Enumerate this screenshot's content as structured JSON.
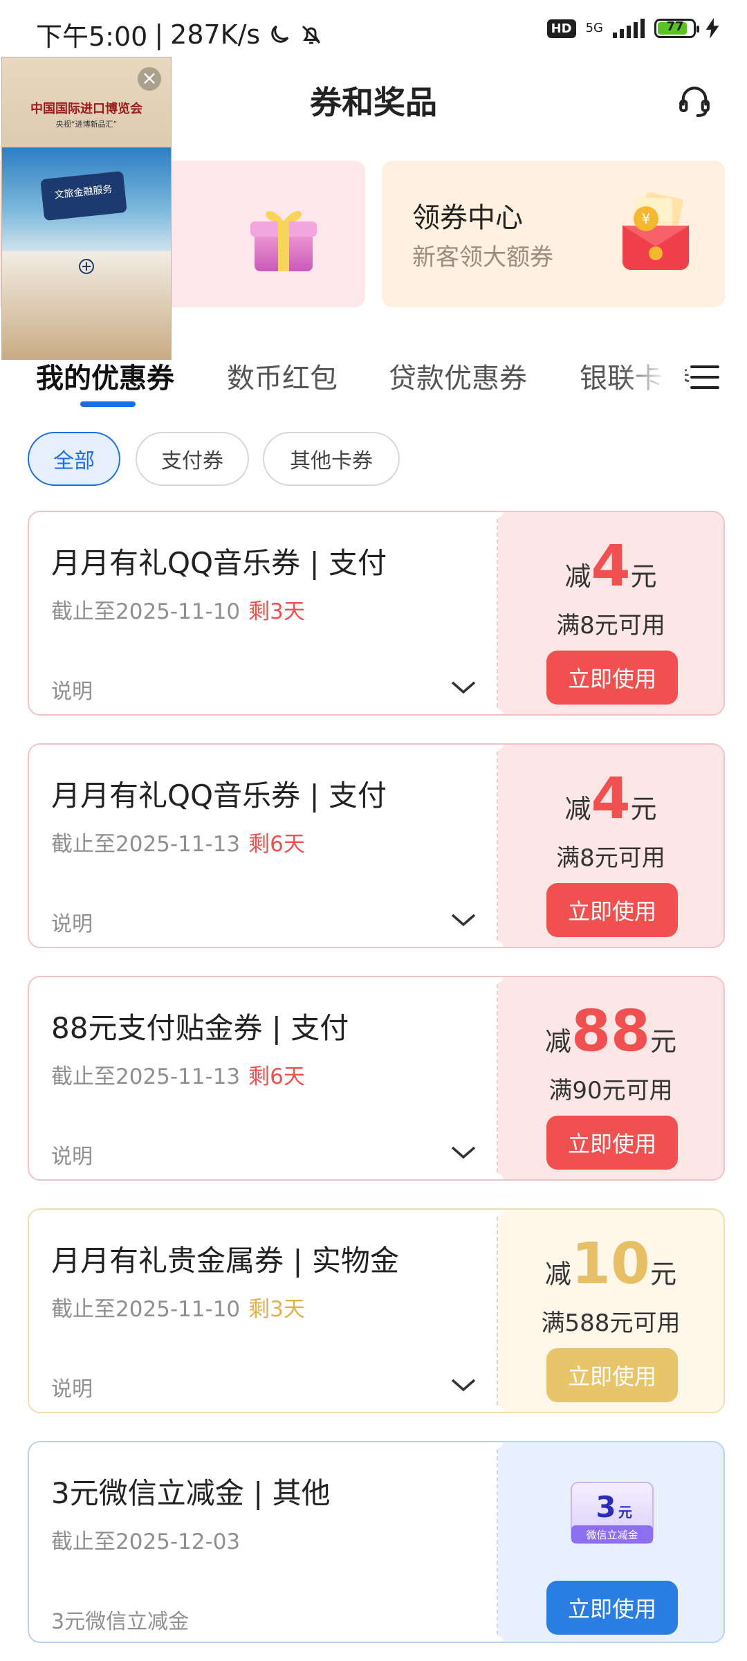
{
  "status_bar": {
    "time": "下午5:00",
    "speed": "287K/s",
    "hd": "HD",
    "network": "5G",
    "battery": "77"
  },
  "header": {
    "title": "券和奖品"
  },
  "promo": {
    "right_title": "领券中心",
    "right_subtitle": "新客领大额券"
  },
  "ad": {
    "headline": "中国国际进口博览会",
    "subline": "央视“进博新品汇”",
    "badge": "文旅金融服务"
  },
  "tabs": [
    {
      "label": "我的优惠券",
      "active": true
    },
    {
      "label": "数币红包",
      "active": false
    },
    {
      "label": "贷款优惠券",
      "active": false
    },
    {
      "label": "银联卡券",
      "active": false
    }
  ],
  "filters": [
    {
      "label": "全部",
      "active": true
    },
    {
      "label": "支付券",
      "active": false
    },
    {
      "label": "其他卡券",
      "active": false
    }
  ],
  "coupons": [
    {
      "title": "月月有礼QQ音乐券 | 支付",
      "date": "截止至2025-11-10",
      "remaining": "剩3天",
      "note": "说明",
      "prefix": "减",
      "amount": "4",
      "suffix": "元",
      "condition": "满8元可用",
      "button": "立即使用",
      "theme": "red"
    },
    {
      "title": "月月有礼QQ音乐券 | 支付",
      "date": "截止至2025-11-13",
      "remaining": "剩6天",
      "note": "说明",
      "prefix": "减",
      "amount": "4",
      "suffix": "元",
      "condition": "满8元可用",
      "button": "立即使用",
      "theme": "red"
    },
    {
      "title": "88元支付贴金券 | 支付",
      "date": "截止至2025-11-13",
      "remaining": "剩6天",
      "note": "说明",
      "prefix": "减",
      "amount": "88",
      "suffix": "元",
      "condition": "满90元可用",
      "button": "立即使用",
      "theme": "red"
    },
    {
      "title": "月月有礼贵金属券 | 实物金",
      "date": "截止至2025-11-10",
      "remaining": "剩3天",
      "note": "说明",
      "prefix": "减",
      "amount": "10",
      "suffix": "元",
      "condition": "满588元可用",
      "button": "立即使用",
      "theme": "gold"
    },
    {
      "title": "3元微信立减金 |  其他",
      "date": "截止至2025-12-03",
      "remaining": "",
      "note": "3元微信立减金",
      "ticket_amount": "3",
      "ticket_unit": "元",
      "ticket_label": "微信立减金",
      "button": "立即使用",
      "theme": "blue"
    }
  ]
}
